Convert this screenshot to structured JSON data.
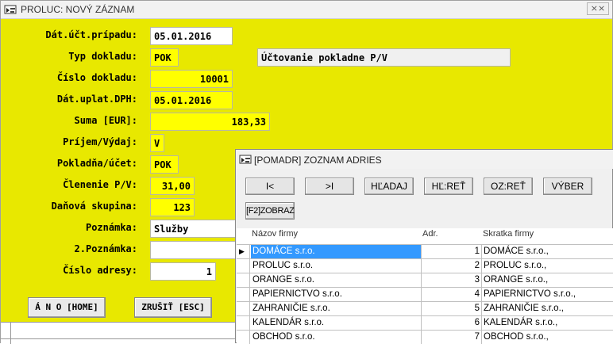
{
  "main_window": {
    "title": "PROLUC: NOVÝ ZÁZNAM",
    "close_glyph": "⨯⨯",
    "fields": {
      "dat_uct_pripadu": {
        "label": "Dát.účt.prípadu:",
        "value": "05.01.2016"
      },
      "typ_dokladu": {
        "label": "Typ dokladu:",
        "value": "POK",
        "description": "Účtovanie pokladne P/V"
      },
      "cislo_dokladu": {
        "label": "Číslo dokladu:",
        "value": "10001"
      },
      "dat_uplat_dph": {
        "label": "Dát.uplat.DPH:",
        "value": "05.01.2016"
      },
      "suma": {
        "label": "Suma [EUR]:",
        "value": "183,33"
      },
      "prijem_vydaj": {
        "label": "Príjem/Výdaj:",
        "value": "V"
      },
      "pokladna_ucet": {
        "label": "Pokladňa/účet:",
        "value": "POK"
      },
      "clenenie_pv": {
        "label": "Členenie P/V:",
        "value": "31,00"
      },
      "danova_skupina": {
        "label": "Daňová skupina:",
        "value": "123"
      },
      "poznamka": {
        "label": "Poznámka:",
        "value": "Služby"
      },
      "poznamka2": {
        "label": "2.Poznámka:",
        "value": ""
      },
      "cislo_adresy": {
        "label": "Číslo adresy:",
        "value": "1"
      }
    },
    "buttons": {
      "ano": "Á N O [HOME]",
      "zrusit": "ZRUŠIŤ [ESC]"
    }
  },
  "address_window": {
    "title": "[POMADR] ZOZNAM ADRIES",
    "buttons": {
      "first": "I<",
      "last": ">I",
      "hladaj": "HĽADAJ",
      "hl_ret": "HĽ:REŤ",
      "oz_ret": "OZ:REŤ",
      "vyber": "VÝBER",
      "zobraz": "[F2]ZOBRAZ"
    },
    "columns": [
      "Názov firmy",
      "Adr.",
      "Skratka firmy"
    ],
    "rows": [
      {
        "name": "DOMÁCE s.r.o.",
        "adr": "1",
        "short": "DOMÁCE s.r.o.,"
      },
      {
        "name": "PROLUC s.r.o.",
        "adr": "2",
        "short": "PROLUC s.r.o.,"
      },
      {
        "name": "ORANGE s.r.o.",
        "adr": "3",
        "short": "ORANGE s.r.o.,"
      },
      {
        "name": "PAPIERNICTVO s.r.o.",
        "adr": "4",
        "short": "PAPIERNICTVO s.r.o.,"
      },
      {
        "name": "ZAHRANIČIE s.r.o.",
        "adr": "5",
        "short": "ZAHRANIČIE s.r.o.,"
      },
      {
        "name": "KALENDÁR s.r.o.",
        "adr": "6",
        "short": "KALENDÁR s.r.o.,"
      },
      {
        "name": "OBCHOD s.r.o.",
        "adr": "7",
        "short": "OBCHOD s.r.o.,"
      }
    ],
    "row_indicator": "▶"
  }
}
